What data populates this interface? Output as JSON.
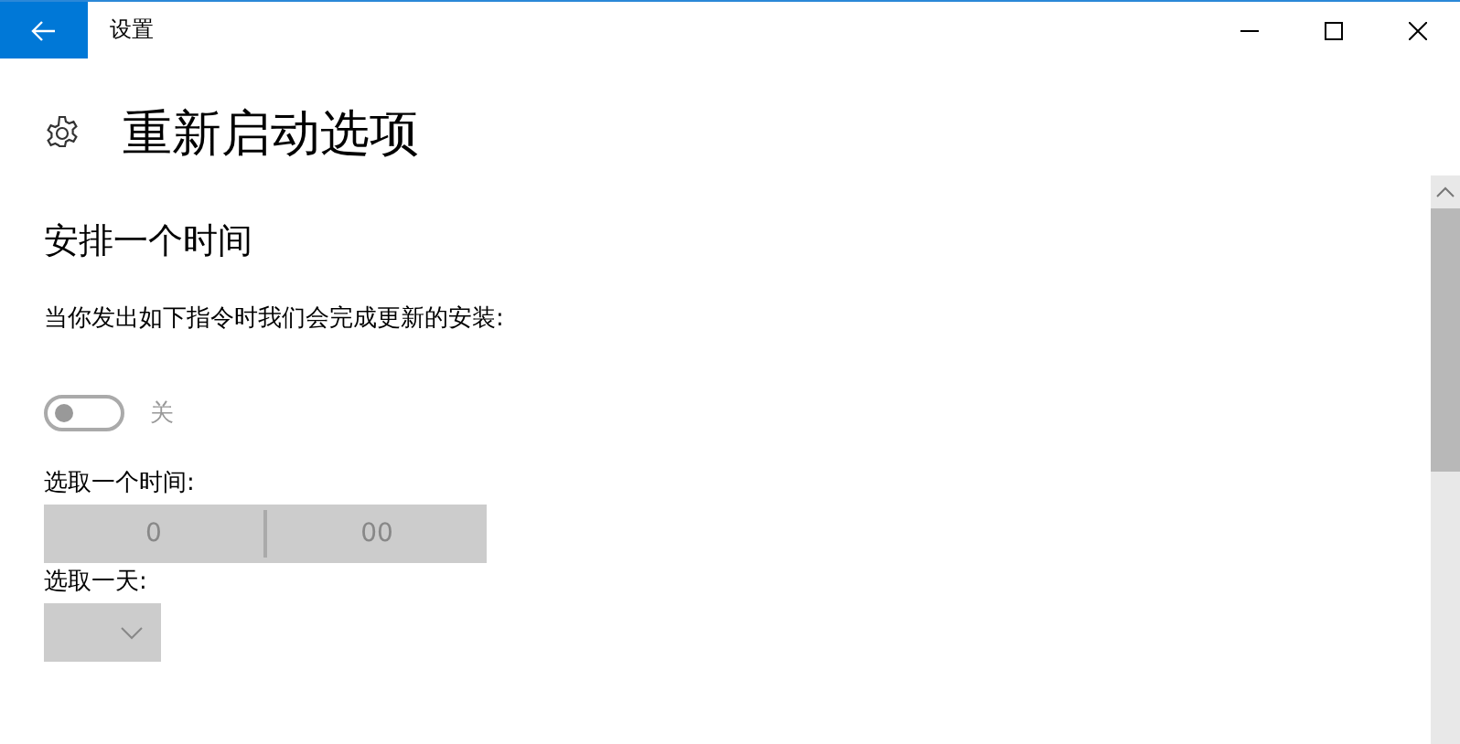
{
  "window": {
    "title": "设置"
  },
  "page": {
    "title": "重新启动选项"
  },
  "section": {
    "title": "安排一个时间",
    "description": "当你发出如下指令时我们会完成更新的安装:"
  },
  "toggle": {
    "on": false,
    "label": "关"
  },
  "time_picker": {
    "label": "选取一个时间:",
    "hour": "0",
    "minute": "00"
  },
  "day_picker": {
    "label": "选取一天:"
  }
}
